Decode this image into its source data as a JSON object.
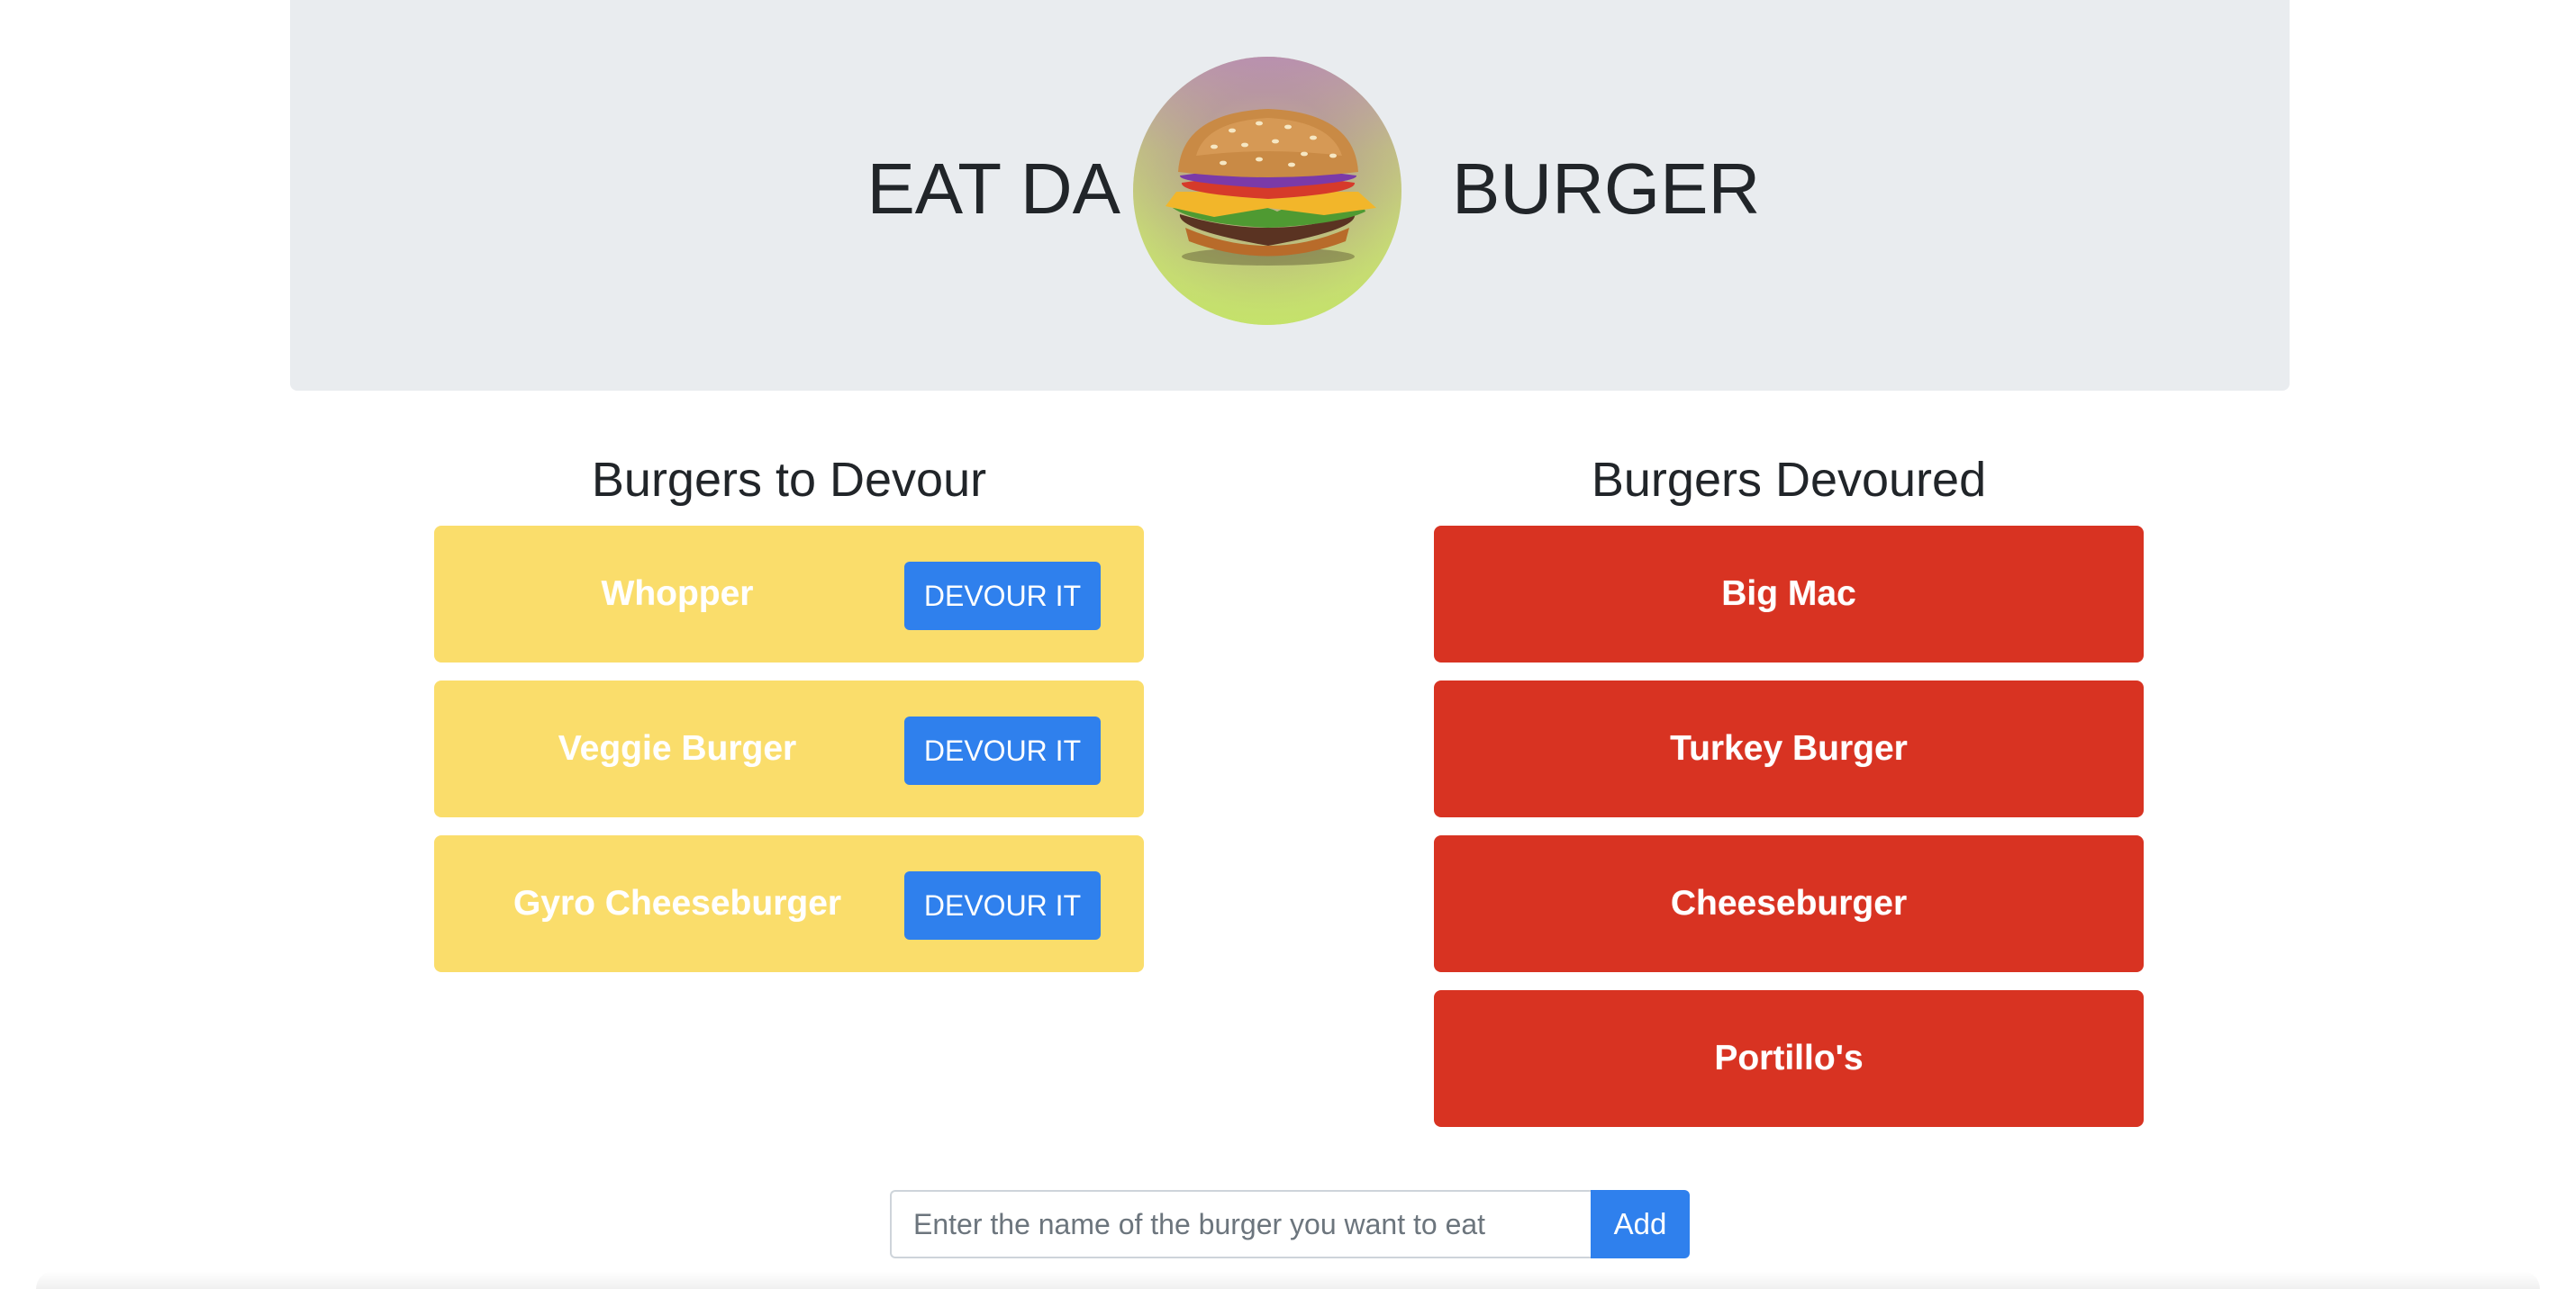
{
  "header": {
    "title_left": "EAT DA",
    "title_right": "BURGER",
    "logo_icon": "burger-icon"
  },
  "to_devour": {
    "title": "Burgers to Devour",
    "button_label": "DEVOUR IT",
    "items": [
      {
        "name": "Whopper"
      },
      {
        "name": "Veggie Burger"
      },
      {
        "name": "Gyro Cheeseburger"
      }
    ],
    "card_color": "#fadd6b",
    "button_color": "#2f80ed"
  },
  "devoured": {
    "title": "Burgers Devoured",
    "items": [
      {
        "name": "Big Mac"
      },
      {
        "name": "Turkey Burger"
      },
      {
        "name": "Cheeseburger"
      },
      {
        "name": "Portillo's"
      }
    ],
    "card_color": "#d83322"
  },
  "form": {
    "placeholder": "Enter the name of the burger you want to eat",
    "value": "",
    "add_label": "Add"
  }
}
